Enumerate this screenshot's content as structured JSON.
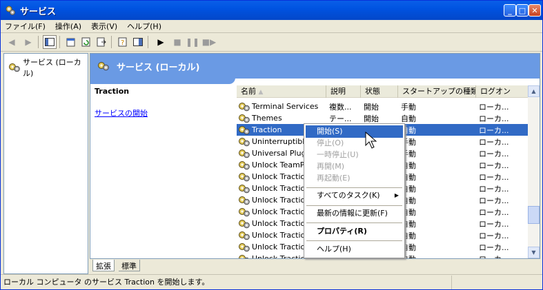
{
  "window": {
    "title": "サービス",
    "min": "_",
    "max": "□",
    "close": "✕"
  },
  "menu": [
    "ファイル(F)",
    "操作(A)",
    "表示(V)",
    "ヘルプ(H)"
  ],
  "tree": {
    "root": "サービス (ローカル)"
  },
  "banner": {
    "title": "サービス (ローカル)"
  },
  "description": {
    "service_name": "Traction",
    "start_link": "サービスの開始"
  },
  "columns": [
    "名前",
    "説明",
    "状態",
    "スタートアップの種類",
    "ログオン"
  ],
  "services": [
    {
      "name": "Terminal Services",
      "description": "複数...",
      "status": "開始",
      "startup": "手動",
      "logon": "ローカ..."
    },
    {
      "name": "Themes",
      "description": "テー...",
      "status": "開始",
      "startup": "自動",
      "logon": "ローカ..."
    },
    {
      "name": "Traction",
      "description": "",
      "status": "",
      "startup": "自動",
      "logon": "ローカ...",
      "selected": true
    },
    {
      "name": "Uninterruptible",
      "description": "",
      "status": "",
      "startup": "手動",
      "logon": "ローカ..."
    },
    {
      "name": "Universal Plug a",
      "description": "",
      "status": "",
      "startup": "手動",
      "logon": "ローカ..."
    },
    {
      "name": "Unlock TeamPac",
      "description": "",
      "status": "",
      "startup": "自動",
      "logon": "ローカ..."
    },
    {
      "name": "Unlock Traction",
      "description": "",
      "status": "",
      "startup": "自動",
      "logon": "ローカ..."
    },
    {
      "name": "Unlock Traction",
      "description": "",
      "status": "",
      "startup": "自動",
      "logon": "ローカ..."
    },
    {
      "name": "Unlock Traction",
      "description": "",
      "status": "",
      "startup": "自動",
      "logon": "ローカ..."
    },
    {
      "name": "Unlock Traction",
      "description": "",
      "status": "",
      "startup": "自動",
      "logon": "ローカ..."
    },
    {
      "name": "Unlock Traction",
      "description": "",
      "status": "",
      "startup": "自動",
      "logon": "ローカ..."
    },
    {
      "name": "Unlock Traction",
      "description": "",
      "status": "",
      "startup": "自動",
      "logon": "ローカ..."
    },
    {
      "name": "Unlock Traction",
      "description": "",
      "status": "",
      "startup": "自動",
      "logon": "ローカ..."
    },
    {
      "name": "Unlock Traction",
      "description": "",
      "status": "",
      "startup": "自動",
      "logon": "ローカ..."
    }
  ],
  "context_menu": {
    "start": "開始(S)",
    "stop": "停止(O)",
    "pause": "一時停止(U)",
    "resume": "再開(M)",
    "restart": "再起動(E)",
    "all_tasks": "すべてのタスク(K)",
    "refresh": "最新の情報に更新(F)",
    "properties": "プロパティ(R)",
    "help": "ヘルプ(H)"
  },
  "tabs": [
    "拡張",
    "標準"
  ],
  "statusbar": {
    "text": "ローカル コンピュータ のサービス Traction を開始します。"
  }
}
